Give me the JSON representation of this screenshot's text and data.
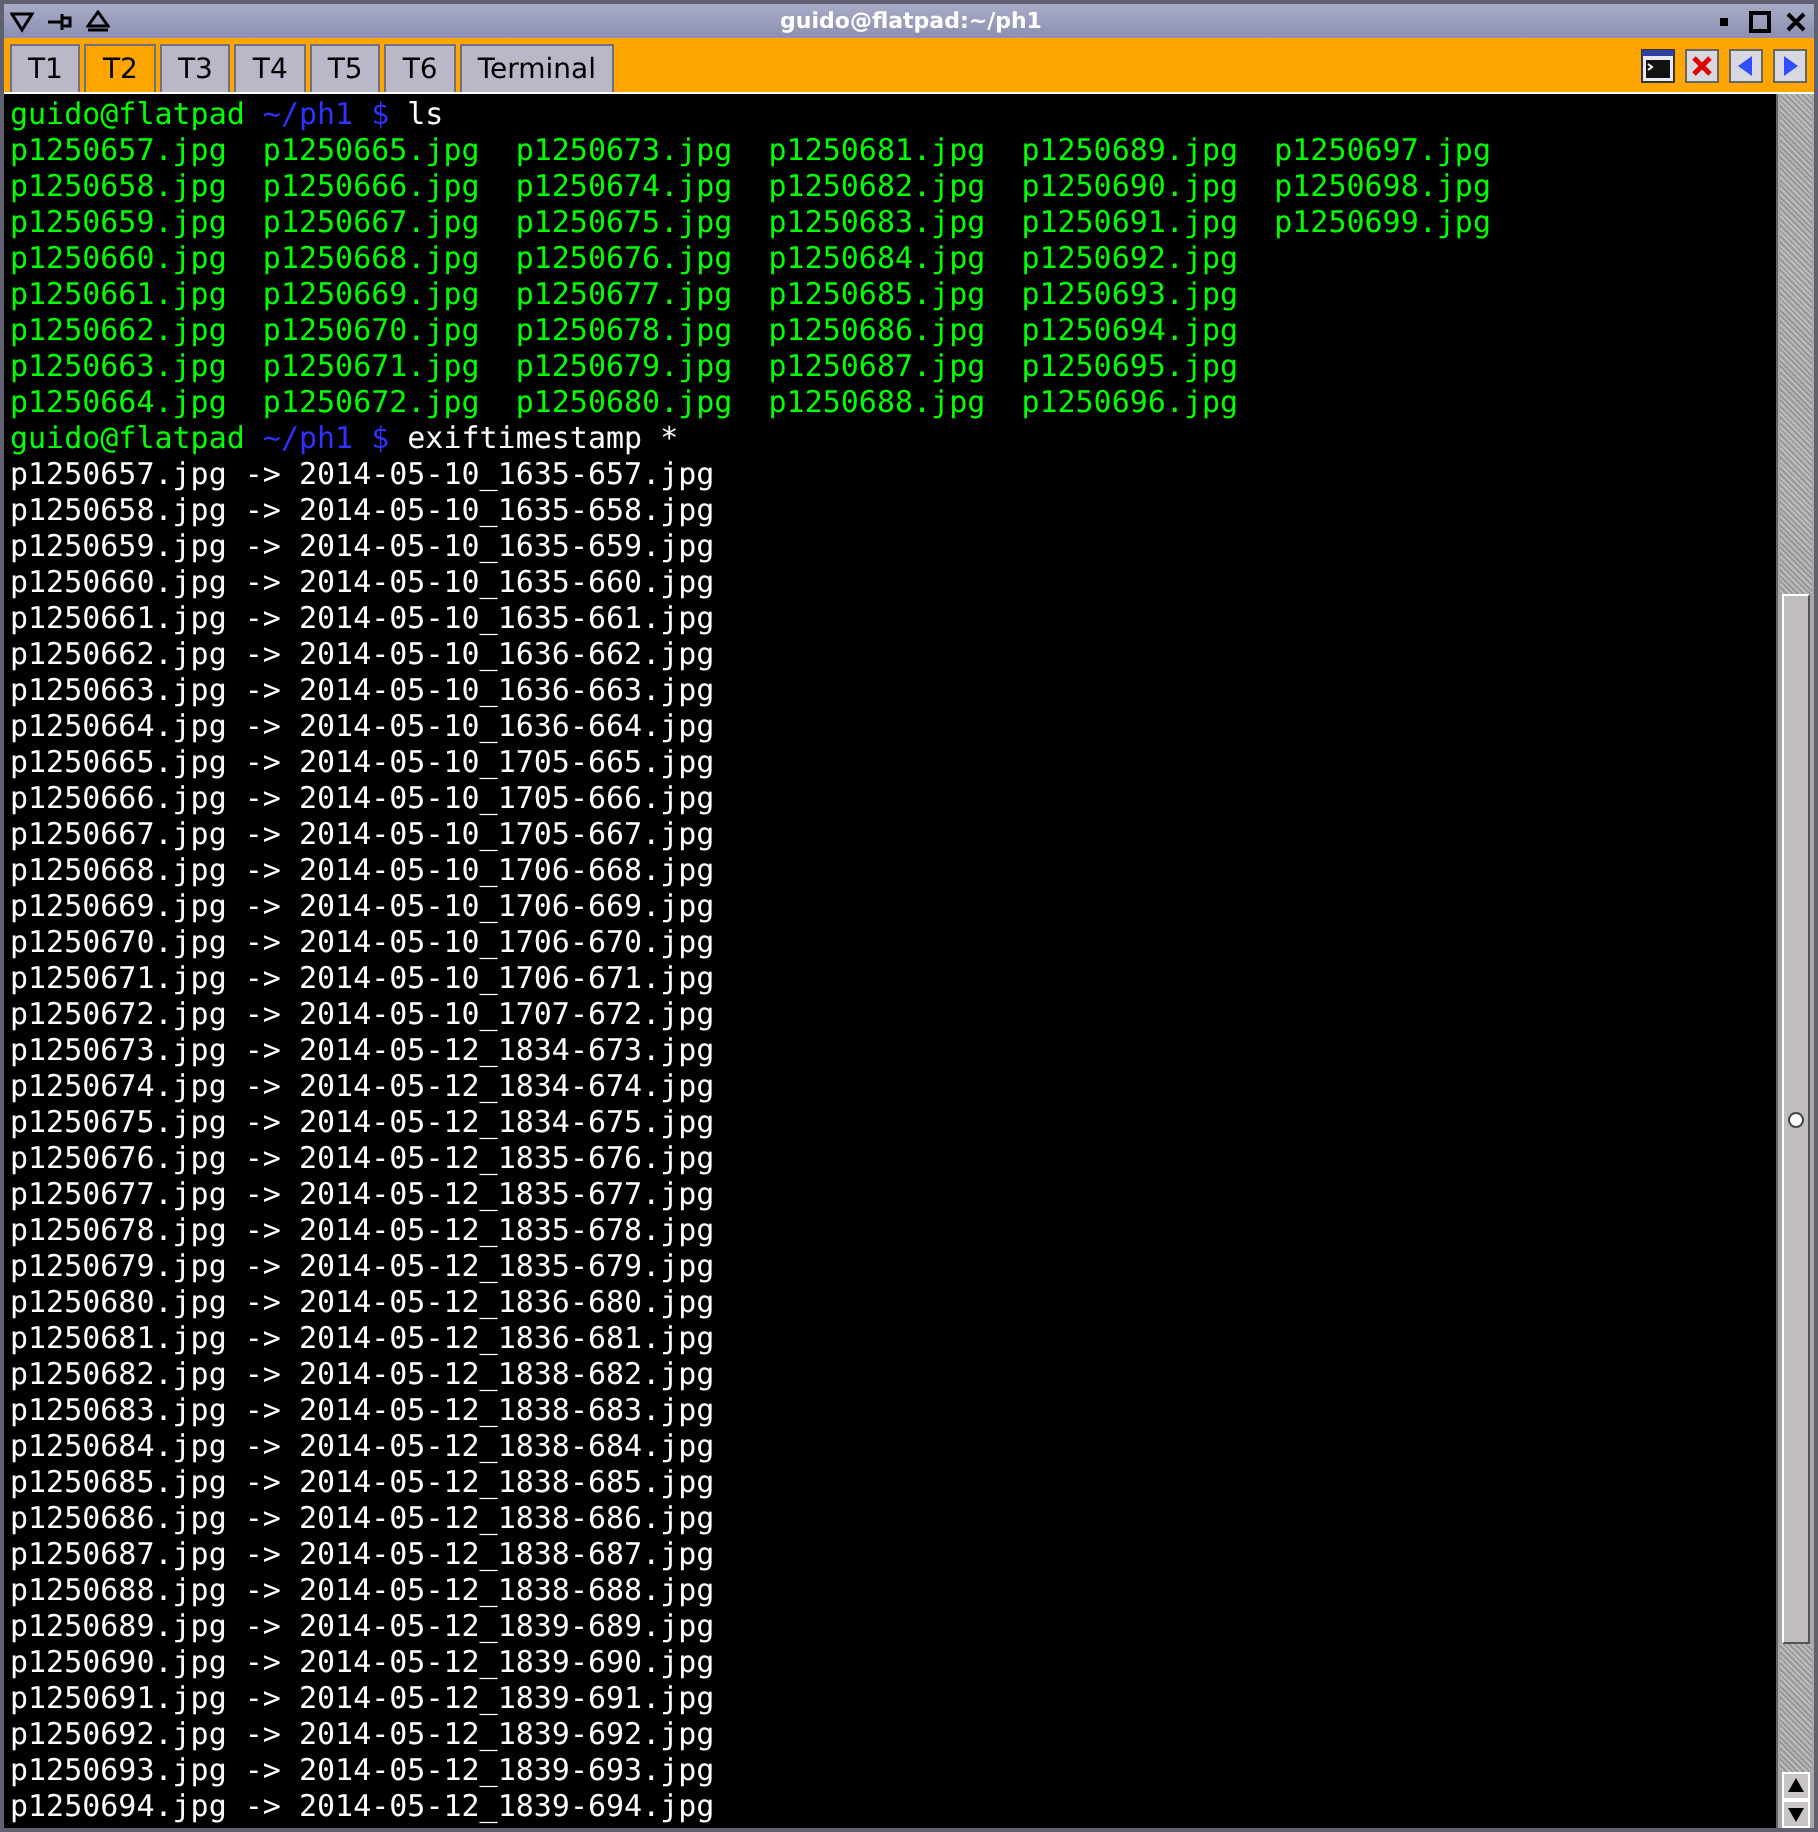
{
  "window": {
    "title": "guido@flatpad:~/ph1"
  },
  "tabs": [
    {
      "label": "T1",
      "selected": false
    },
    {
      "label": "T2",
      "selected": true
    },
    {
      "label": "T3",
      "selected": false
    },
    {
      "label": "T4",
      "selected": false
    },
    {
      "label": "T5",
      "selected": false
    },
    {
      "label": "T6",
      "selected": false
    },
    {
      "label": "Terminal",
      "selected": false
    }
  ],
  "terminal": {
    "lines": [
      {
        "kind": "prompt",
        "user_host": "guido@flatpad",
        "path": "~/ph1",
        "symbol": "$",
        "command": "ls"
      },
      {
        "kind": "listing",
        "cells": [
          "p1250657.jpg",
          "p1250665.jpg",
          "p1250673.jpg",
          "p1250681.jpg",
          "p1250689.jpg",
          "p1250697.jpg"
        ]
      },
      {
        "kind": "listing",
        "cells": [
          "p1250658.jpg",
          "p1250666.jpg",
          "p1250674.jpg",
          "p1250682.jpg",
          "p1250690.jpg",
          "p1250698.jpg"
        ]
      },
      {
        "kind": "listing",
        "cells": [
          "p1250659.jpg",
          "p1250667.jpg",
          "p1250675.jpg",
          "p1250683.jpg",
          "p1250691.jpg",
          "p1250699.jpg"
        ]
      },
      {
        "kind": "listing",
        "cells": [
          "p1250660.jpg",
          "p1250668.jpg",
          "p1250676.jpg",
          "p1250684.jpg",
          "p1250692.jpg"
        ]
      },
      {
        "kind": "listing",
        "cells": [
          "p1250661.jpg",
          "p1250669.jpg",
          "p1250677.jpg",
          "p1250685.jpg",
          "p1250693.jpg"
        ]
      },
      {
        "kind": "listing",
        "cells": [
          "p1250662.jpg",
          "p1250670.jpg",
          "p1250678.jpg",
          "p1250686.jpg",
          "p1250694.jpg"
        ]
      },
      {
        "kind": "listing",
        "cells": [
          "p1250663.jpg",
          "p1250671.jpg",
          "p1250679.jpg",
          "p1250687.jpg",
          "p1250695.jpg"
        ]
      },
      {
        "kind": "listing",
        "cells": [
          "p1250664.jpg",
          "p1250672.jpg",
          "p1250680.jpg",
          "p1250688.jpg",
          "p1250696.jpg"
        ]
      },
      {
        "kind": "prompt",
        "user_host": "guido@flatpad",
        "path": "~/ph1",
        "symbol": "$",
        "command": "exiftimestamp *"
      },
      {
        "kind": "output",
        "text": "p1250657.jpg -> 2014-05-10_1635-657.jpg"
      },
      {
        "kind": "output",
        "text": "p1250658.jpg -> 2014-05-10_1635-658.jpg"
      },
      {
        "kind": "output",
        "text": "p1250659.jpg -> 2014-05-10_1635-659.jpg"
      },
      {
        "kind": "output",
        "text": "p1250660.jpg -> 2014-05-10_1635-660.jpg"
      },
      {
        "kind": "output",
        "text": "p1250661.jpg -> 2014-05-10_1635-661.jpg"
      },
      {
        "kind": "output",
        "text": "p1250662.jpg -> 2014-05-10_1636-662.jpg"
      },
      {
        "kind": "output",
        "text": "p1250663.jpg -> 2014-05-10_1636-663.jpg"
      },
      {
        "kind": "output",
        "text": "p1250664.jpg -> 2014-05-10_1636-664.jpg"
      },
      {
        "kind": "output",
        "text": "p1250665.jpg -> 2014-05-10_1705-665.jpg"
      },
      {
        "kind": "output",
        "text": "p1250666.jpg -> 2014-05-10_1705-666.jpg"
      },
      {
        "kind": "output",
        "text": "p1250667.jpg -> 2014-05-10_1705-667.jpg"
      },
      {
        "kind": "output",
        "text": "p1250668.jpg -> 2014-05-10_1706-668.jpg"
      },
      {
        "kind": "output",
        "text": "p1250669.jpg -> 2014-05-10_1706-669.jpg"
      },
      {
        "kind": "output",
        "text": "p1250670.jpg -> 2014-05-10_1706-670.jpg"
      },
      {
        "kind": "output",
        "text": "p1250671.jpg -> 2014-05-10_1706-671.jpg"
      },
      {
        "kind": "output",
        "text": "p1250672.jpg -> 2014-05-10_1707-672.jpg"
      },
      {
        "kind": "output",
        "text": "p1250673.jpg -> 2014-05-12_1834-673.jpg"
      },
      {
        "kind": "output",
        "text": "p1250674.jpg -> 2014-05-12_1834-674.jpg"
      },
      {
        "kind": "output",
        "text": "p1250675.jpg -> 2014-05-12_1834-675.jpg"
      },
      {
        "kind": "output",
        "text": "p1250676.jpg -> 2014-05-12_1835-676.jpg"
      },
      {
        "kind": "output",
        "text": "p1250677.jpg -> 2014-05-12_1835-677.jpg"
      },
      {
        "kind": "output",
        "text": "p1250678.jpg -> 2014-05-12_1835-678.jpg"
      },
      {
        "kind": "output",
        "text": "p1250679.jpg -> 2014-05-12_1835-679.jpg"
      },
      {
        "kind": "output",
        "text": "p1250680.jpg -> 2014-05-12_1836-680.jpg"
      },
      {
        "kind": "output",
        "text": "p1250681.jpg -> 2014-05-12_1836-681.jpg"
      },
      {
        "kind": "output",
        "text": "p1250682.jpg -> 2014-05-12_1838-682.jpg"
      },
      {
        "kind": "output",
        "text": "p1250683.jpg -> 2014-05-12_1838-683.jpg"
      },
      {
        "kind": "output",
        "text": "p1250684.jpg -> 2014-05-12_1838-684.jpg"
      },
      {
        "kind": "output",
        "text": "p1250685.jpg -> 2014-05-12_1838-685.jpg"
      },
      {
        "kind": "output",
        "text": "p1250686.jpg -> 2014-05-12_1838-686.jpg"
      },
      {
        "kind": "output",
        "text": "p1250687.jpg -> 2014-05-12_1838-687.jpg"
      },
      {
        "kind": "output",
        "text": "p1250688.jpg -> 2014-05-12_1838-688.jpg"
      },
      {
        "kind": "output",
        "text": "p1250689.jpg -> 2014-05-12_1839-689.jpg"
      },
      {
        "kind": "output",
        "text": "p1250690.jpg -> 2014-05-12_1839-690.jpg"
      },
      {
        "kind": "output",
        "text": "p1250691.jpg -> 2014-05-12_1839-691.jpg"
      },
      {
        "kind": "output",
        "text": "p1250692.jpg -> 2014-05-12_1839-692.jpg"
      },
      {
        "kind": "output",
        "text": "p1250693.jpg -> 2014-05-12_1839-693.jpg"
      },
      {
        "kind": "output",
        "text": "p1250694.jpg -> 2014-05-12_1839-694.jpg"
      }
    ]
  }
}
